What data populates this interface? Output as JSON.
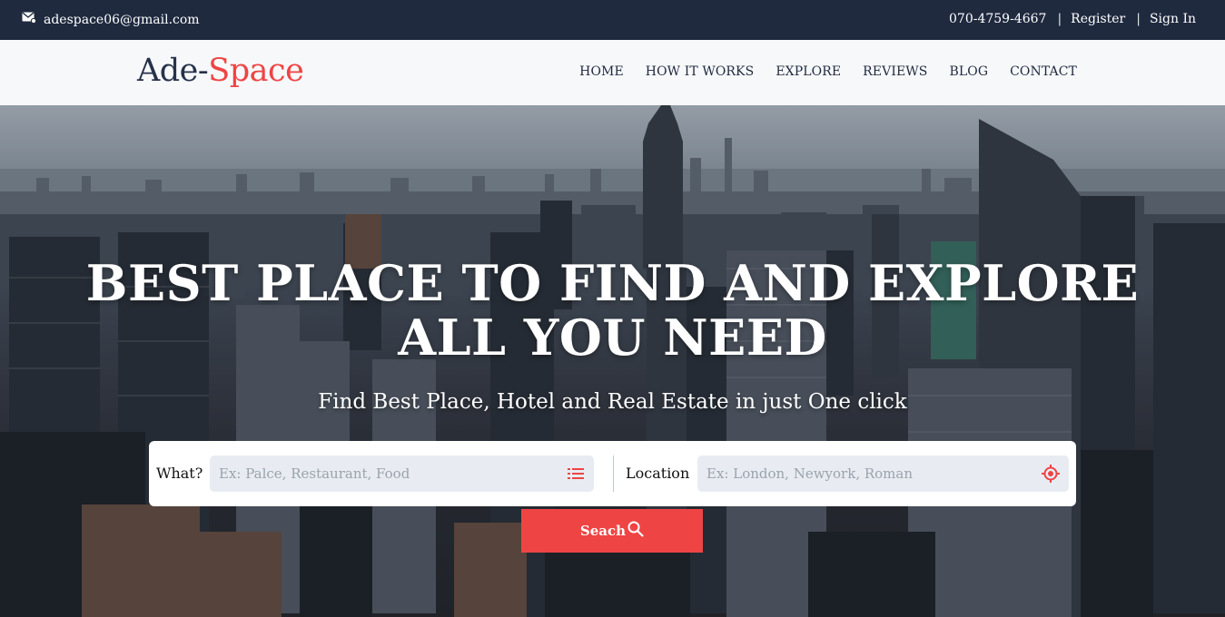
{
  "topbar": {
    "email": "adespace06@gmail.com",
    "phone": "070-4759-4667",
    "register": "Register",
    "signin": "Sign In"
  },
  "brand": {
    "part1": "Ade-",
    "part2": "Space",
    "accent": "#ef4444",
    "dark": "#26324a"
  },
  "nav": {
    "items": [
      "HOME",
      "HOW IT WORKS",
      "EXPLORE",
      "REVIEWS",
      "BLOG",
      "CONTACT"
    ]
  },
  "hero": {
    "title_line1": "BEST PLACE TO FIND AND EXPLORE",
    "title_line2": "ALL YOU NEED",
    "subtitle": "Find Best Place, Hotel and Real Estate in just One click"
  },
  "search": {
    "what_label": "What?",
    "what_placeholder": "Ex: Palce, Restaurant, Food",
    "what_icon": "list-icon",
    "location_label": "Location",
    "location_placeholder": "Ex: London, Newyork, Roman",
    "location_icon": "crosshair-icon",
    "button_label": "Seach",
    "button_icon": "search-icon"
  },
  "colors": {
    "topbar": "#1f2a3f",
    "accent": "#ef4444"
  }
}
